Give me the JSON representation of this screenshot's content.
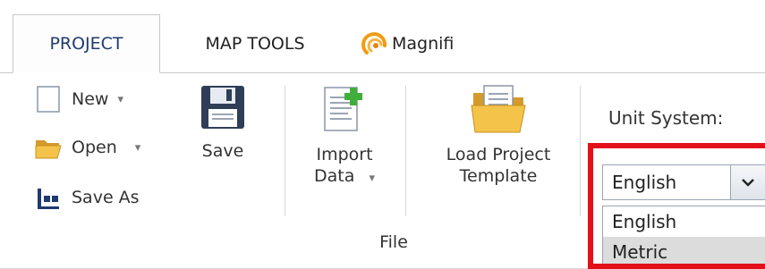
{
  "tabs": {
    "project": "PROJECT",
    "map_tools": "MAP TOOLS",
    "magnifi": "Magnifi"
  },
  "file_group": {
    "new_label": "New",
    "open_label": "Open",
    "save_as_label": "Save As",
    "save_label": "Save",
    "import_line1": "Import",
    "import_line2": "Data",
    "load_line1": "Load Project",
    "load_line2": "Template",
    "group_label": "File"
  },
  "unit_system": {
    "label": "Unit System:",
    "selected": "English",
    "options": [
      "English",
      "Metric"
    ],
    "hovered_option": "Metric"
  },
  "colors": {
    "highlight": "#e3101a",
    "accent_tab_text": "#1f3b6e"
  },
  "icons": {
    "new": "blank-document-icon",
    "open": "folder-open-icon",
    "save_as": "save-as-icon",
    "save": "floppy-disk-icon",
    "import": "document-add-icon",
    "load_template": "folder-document-icon",
    "magnifi": "magnifi-logo-icon",
    "dropdown": "chevron-down-icon"
  }
}
